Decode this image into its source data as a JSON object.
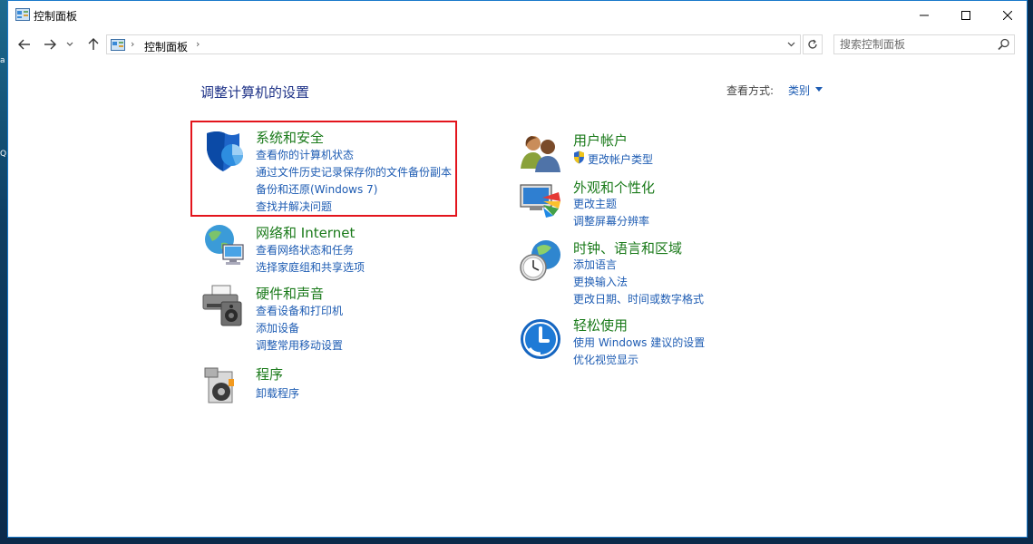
{
  "window": {
    "title": "控制面板"
  },
  "address": {
    "crumb": "控制面板",
    "separator": "›"
  },
  "search": {
    "placeholder": "搜索控制面板"
  },
  "content": {
    "heading": "调整计算机的设置",
    "view_by_label": "查看方式:",
    "view_by_value": "类别"
  },
  "categories": [
    {
      "title": "系统和安全",
      "icon": "shield-icon",
      "links": [
        "查看你的计算机状态",
        "通过文件历史记录保存你的文件备份副本",
        "备份和还原(Windows 7)",
        "查找并解决问题"
      ]
    },
    {
      "title": "网络和 Internet",
      "icon": "network-globe-icon",
      "links": [
        "查看网络状态和任务",
        "选择家庭组和共享选项"
      ]
    },
    {
      "title": "硬件和声音",
      "icon": "printer-speaker-icon",
      "links": [
        "查看设备和打印机",
        "添加设备",
        "调整常用移动设置"
      ]
    },
    {
      "title": "程序",
      "icon": "programs-icon",
      "links": [
        "卸载程序"
      ]
    },
    {
      "title": "用户帐户",
      "icon": "users-icon",
      "links": [
        "更改帐户类型"
      ]
    },
    {
      "title": "外观和个性化",
      "icon": "appearance-icon",
      "links": [
        "更改主题",
        "调整屏幕分辨率"
      ]
    },
    {
      "title": "时钟、语言和区域",
      "icon": "clock-globe-icon",
      "links": [
        "添加语言",
        "更换输入法",
        "更改日期、时间或数字格式"
      ]
    },
    {
      "title": "轻松使用",
      "icon": "ease-of-access-icon",
      "links": [
        "使用 Windows 建议的设置",
        "优化视觉显示"
      ]
    }
  ],
  "desktop_edge": {
    "glyph_1": "a",
    "glyph_2": "Q"
  },
  "colors": {
    "accent_link": "#1e5cb3",
    "category_title": "#1a7a1a",
    "heading": "#1e3287",
    "highlight_border": "#e3141c"
  }
}
